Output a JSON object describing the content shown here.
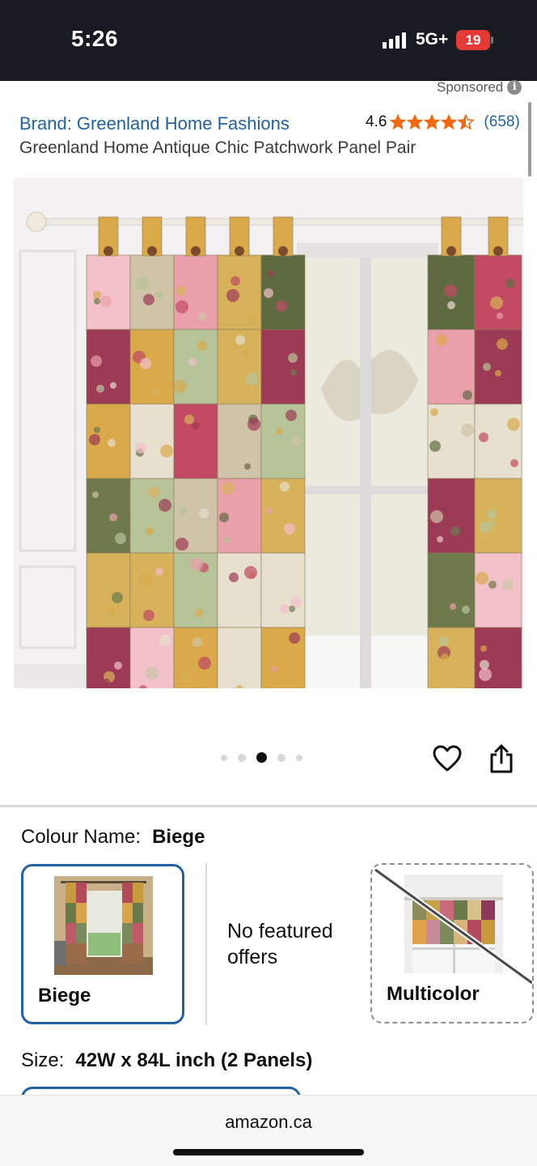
{
  "status_bar": {
    "time": "5:26",
    "network": "5G+",
    "battery": "19"
  },
  "header": {
    "sponsored": "Sponsored",
    "info_icon": "i",
    "brand": "Brand: Greenland Home Fashions",
    "rating_value": "4.6",
    "rating_stars": 4.5,
    "rating_count": "(658)",
    "title": "Greenland Home Antique Chic Patchwork Panel Pair"
  },
  "gallery": {
    "image_count": 5,
    "active_index": 2
  },
  "colour": {
    "label": "Colour Name:",
    "value": "Biege",
    "options": [
      {
        "name": "Biege",
        "selected": true,
        "available": true
      },
      {
        "name": "No featured offers"
      },
      {
        "name": "Multicolor",
        "selected": false,
        "available": false
      }
    ]
  },
  "size": {
    "label": "Size:",
    "value": "42W x 84L inch (2 Panels)"
  },
  "browser": {
    "url": "amazon.ca"
  },
  "colors": {
    "link": "#2162a1",
    "star": "#f3670f",
    "status_bar": "#181c22",
    "selected_border": "#2162a1"
  }
}
